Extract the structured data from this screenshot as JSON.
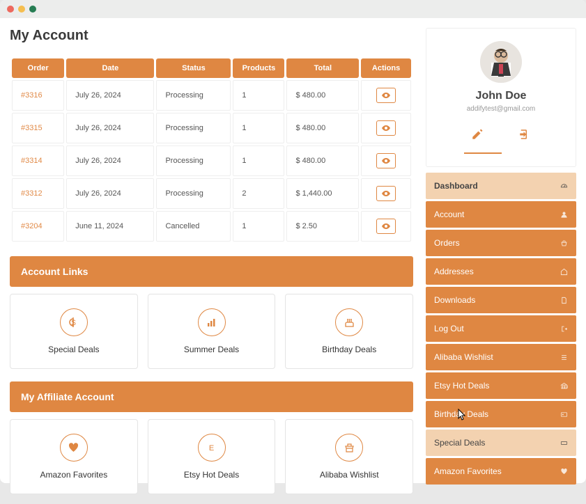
{
  "page_title": "My Account",
  "table": {
    "headers": [
      "Order",
      "Date",
      "Status",
      "Products",
      "Total",
      "Actions"
    ],
    "rows": [
      {
        "id": "#3316",
        "date": "July 26, 2024",
        "status": "Processing",
        "products": "1",
        "total": "$ 480.00"
      },
      {
        "id": "#3315",
        "date": "July 26, 2024",
        "status": "Processing",
        "products": "1",
        "total": "$ 480.00"
      },
      {
        "id": "#3314",
        "date": "July 26, 2024",
        "status": "Processing",
        "products": "1",
        "total": "$ 480.00"
      },
      {
        "id": "#3312",
        "date": "July 26, 2024",
        "status": "Processing",
        "products": "2",
        "total": "$ 1,440.00"
      },
      {
        "id": "#3204",
        "date": "June 11, 2024",
        "status": "Cancelled",
        "products": "1",
        "total": "$ 2.50"
      }
    ]
  },
  "account_links": {
    "title": "Account Links",
    "items": [
      {
        "label": "Special Deals",
        "icon": "dollar"
      },
      {
        "label": "Summer Deals",
        "icon": "chart"
      },
      {
        "label": "Birthday Deals",
        "icon": "cake"
      }
    ]
  },
  "affiliate": {
    "title": "My Affiliate Account",
    "items": [
      {
        "label": "Amazon Favorites",
        "icon": "heart"
      },
      {
        "label": "Etsy Hot Deals",
        "icon": "letter"
      },
      {
        "label": "Alibaba Wishlist",
        "icon": "shop"
      }
    ]
  },
  "profile": {
    "name": "John Doe",
    "email": "addifytest@gmail.com"
  },
  "nav": [
    {
      "label": "Dashboard",
      "icon": "gauge",
      "active": true
    },
    {
      "label": "Account",
      "icon": "user"
    },
    {
      "label": "Orders",
      "icon": "basket"
    },
    {
      "label": "Addresses",
      "icon": "home"
    },
    {
      "label": "Downloads",
      "icon": "file"
    },
    {
      "label": "Log Out",
      "icon": "signout"
    },
    {
      "label": "Alibaba Wishlist",
      "icon": "list"
    },
    {
      "label": "Etsy Hot Deals",
      "icon": "bank"
    },
    {
      "label": "Birthday Deals",
      "icon": "id"
    },
    {
      "label": "Special Deals",
      "icon": "ticket",
      "highlight": true
    },
    {
      "label": "Amazon Favorites",
      "icon": "heart2"
    }
  ]
}
